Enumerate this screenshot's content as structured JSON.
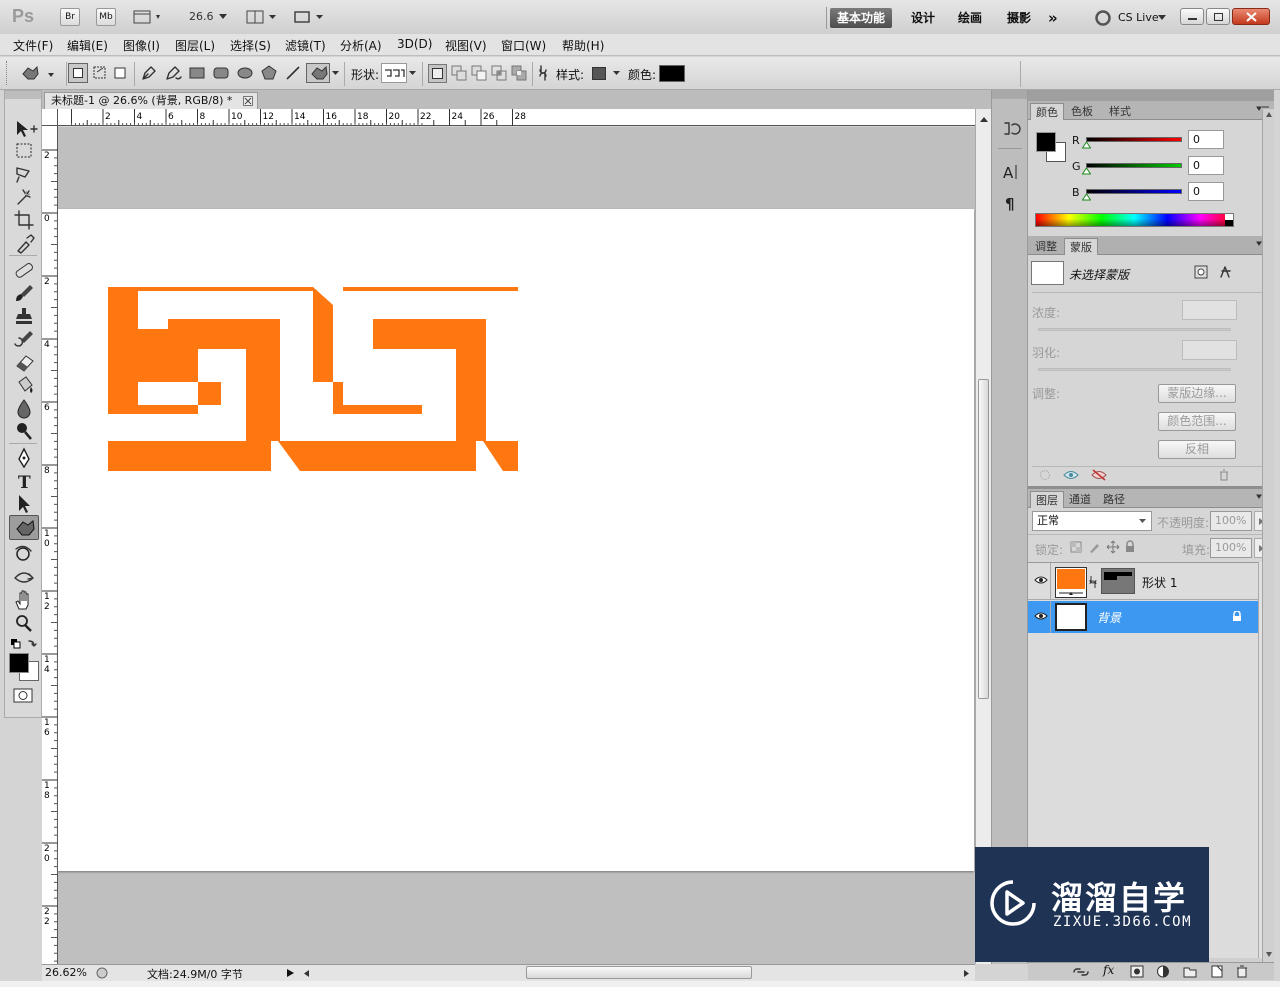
{
  "app": {
    "logo": "Ps",
    "bridge": "Br",
    "minibridge": "Mb",
    "zoom": "26.6"
  },
  "workspaces": {
    "essentials": "基本功能",
    "design": "设计",
    "painting": "绘画",
    "photography": "摄影",
    "more": "»",
    "cslive": "CS Live"
  },
  "menu": [
    "文件(F)",
    "编辑(E)",
    "图像(I)",
    "图层(L)",
    "选择(S)",
    "滤镜(T)",
    "分析(A)",
    "3D(D)",
    "视图(V)",
    "窗口(W)",
    "帮助(H)"
  ],
  "options": {
    "shape_label": "形状:",
    "style_label": "样式:",
    "color_label": "颜色:",
    "shape_color": "#000000",
    "style_color": "#555555"
  },
  "document": {
    "tab_title": "未标题-1 @ 26.6% (背景, RGB/8) *",
    "shape_color": "#ff7711",
    "ruler_h": [
      "2",
      "4",
      "6",
      "8",
      "10",
      "12",
      "14",
      "16",
      "18",
      "20",
      "22",
      "24",
      "26",
      "28"
    ],
    "ruler_v": [
      "2",
      "0",
      "2",
      "4",
      "6",
      "8",
      "10",
      "12",
      "14",
      "16",
      "18",
      "20",
      "22"
    ]
  },
  "status": {
    "zoom": "26.62%",
    "info": "文档:24.9M/0 字节"
  },
  "color_panel": {
    "tabs": [
      "颜色",
      "色板",
      "样式"
    ],
    "r": "0",
    "g": "0",
    "b": "0",
    "r_label": "R",
    "g_label": "G",
    "b_label": "B",
    "foreground": "#000000",
    "background": "#ffffff"
  },
  "masks_panel": {
    "tabs": [
      "调整",
      "蒙版"
    ],
    "no_mask": "未选择蒙版",
    "density_label": "浓度:",
    "feather_label": "羽化:",
    "refine_label": "调整:",
    "mask_edge": "蒙版边缘...",
    "color_range": "颜色范围...",
    "invert": "反相"
  },
  "layers_panel": {
    "tabs": [
      "图层",
      "通道",
      "路径"
    ],
    "blend_mode": "正常",
    "opacity_label": "不透明度:",
    "opacity": "100%",
    "lock_label": "锁定:",
    "fill_label": "填充:",
    "fill": "100%",
    "layers": [
      {
        "name": "形状 1",
        "thumb_color": "#ff7711",
        "selected": false
      },
      {
        "name": "背景",
        "thumb_color": "#ffffff",
        "selected": true
      }
    ],
    "selection_color": "#3d98f2"
  },
  "watermark": {
    "title": "溜溜自学",
    "url": "ZIXUE.3D66.COM",
    "bg": "#1f3355"
  }
}
